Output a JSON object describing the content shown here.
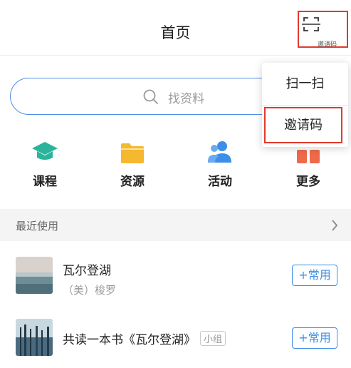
{
  "header": {
    "title": "首页",
    "scan_label": "邀请码",
    "highlight_color": "#e23a2c"
  },
  "popup_menu": {
    "scan": "扫一扫",
    "invite": "邀请码"
  },
  "search": {
    "placeholder": "找资料",
    "border_color": "#4b8de8"
  },
  "categories": [
    {
      "label": "课程",
      "icon": "graduation-cap-icon",
      "color": "#2bb39b"
    },
    {
      "label": "资源",
      "icon": "folder-icon",
      "color": "#f5b82e"
    },
    {
      "label": "活动",
      "icon": "people-icon",
      "color": "#3d8ee8"
    },
    {
      "label": "更多",
      "icon": "grid-icon",
      "color": "#ef6a4a"
    }
  ],
  "recent": {
    "title": "最近使用",
    "items": [
      {
        "title": "瓦尔登湖",
        "subtitle": "（美）梭罗",
        "action": "+常用"
      },
      {
        "title": "共读一本书《瓦尔登湖》",
        "tag": "小组",
        "action": "+常用"
      }
    ]
  }
}
